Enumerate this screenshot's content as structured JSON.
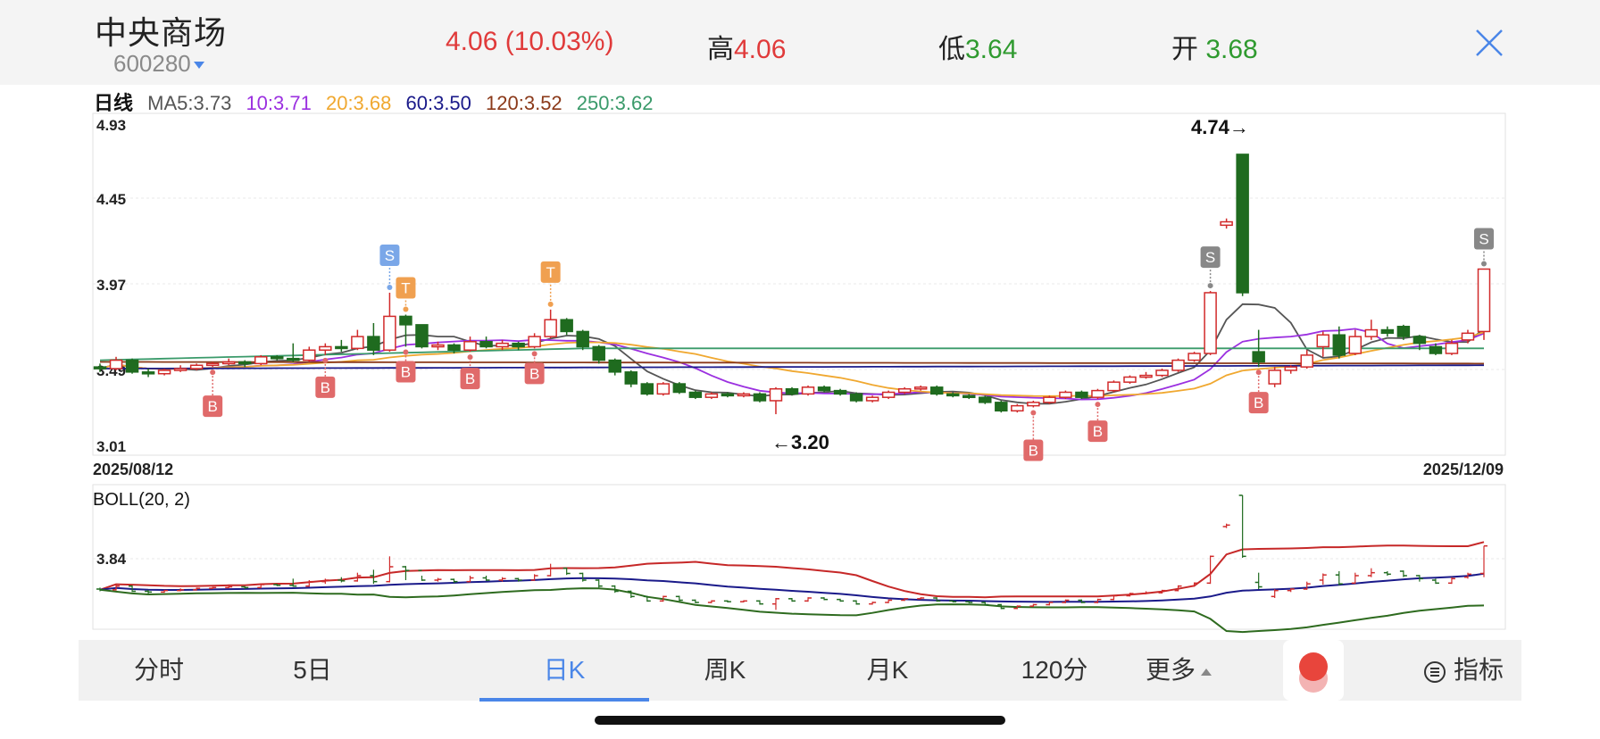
{
  "stock": {
    "name": "中央商场",
    "code": "600280",
    "price": "4.06",
    "change_pct": "(10.03%)",
    "high_label": "高",
    "high_value": "4.06",
    "low_label": "低",
    "low_value": "3.64",
    "open_label": "开",
    "open_value": "3.68"
  },
  "ma_legend": {
    "period": "日线",
    "ma5": "MA5:3.73",
    "ma10": "10:3.71",
    "ma20": "20:3.68",
    "ma60": "60:3.50",
    "ma120": "120:3.52",
    "ma250": "250:3.62"
  },
  "colors": {
    "up": "#d12a2a",
    "down": "#1f6b1f",
    "ma5": "#555555",
    "ma10": "#9b30e0",
    "ma20": "#f0a830",
    "ma60": "#1a1a8a",
    "ma120": "#8b3a1a",
    "ma250": "#3a9a6a",
    "accent": "#4a86e8"
  },
  "chart_data": [
    {
      "type": "candlestick",
      "title": "",
      "y_ticks": [
        "4.93",
        "4.45",
        "3.97",
        "3.49",
        "3.01"
      ],
      "ylim": [
        3.01,
        4.93
      ],
      "x_start_label": "2025/08/12",
      "x_end_label": "2025/12/09",
      "annotations": {
        "max_label": "4.74→",
        "min_label": "←3.20"
      },
      "signals": {
        "buy": "B",
        "sell": "S",
        "t": "T"
      },
      "candles": [
        [
          3.48,
          3.47,
          3.5,
          3.45
        ],
        [
          3.47,
          3.52,
          3.54,
          3.46
        ],
        [
          3.52,
          3.45,
          3.53,
          3.44
        ],
        [
          3.45,
          3.44,
          3.47,
          3.42
        ],
        [
          3.44,
          3.46,
          3.47,
          3.43
        ],
        [
          3.46,
          3.47,
          3.49,
          3.45
        ],
        [
          3.47,
          3.49,
          3.5,
          3.46
        ],
        [
          3.49,
          3.5,
          3.51,
          3.48
        ],
        [
          3.5,
          3.51,
          3.53,
          3.49
        ],
        [
          3.51,
          3.5,
          3.52,
          3.48
        ],
        [
          3.5,
          3.54,
          3.55,
          3.49
        ],
        [
          3.54,
          3.53,
          3.55,
          3.52
        ],
        [
          3.53,
          3.52,
          3.62,
          3.51
        ],
        [
          3.52,
          3.58,
          3.6,
          3.51
        ],
        [
          3.58,
          3.6,
          3.62,
          3.55
        ],
        [
          3.6,
          3.59,
          3.64,
          3.57
        ],
        [
          3.59,
          3.66,
          3.7,
          3.58
        ],
        [
          3.66,
          3.58,
          3.74,
          3.55
        ],
        [
          3.58,
          3.78,
          3.92,
          3.57
        ],
        [
          3.78,
          3.73,
          3.79,
          3.6
        ],
        [
          3.73,
          3.6,
          3.66,
          3.59
        ],
        [
          3.6,
          3.61,
          3.63,
          3.58
        ],
        [
          3.61,
          3.58,
          3.62,
          3.56
        ],
        [
          3.58,
          3.63,
          3.66,
          3.57
        ],
        [
          3.63,
          3.6,
          3.66,
          3.59
        ],
        [
          3.6,
          3.62,
          3.64,
          3.58
        ],
        [
          3.62,
          3.6,
          3.63,
          3.58
        ],
        [
          3.6,
          3.66,
          3.68,
          3.59
        ],
        [
          3.66,
          3.76,
          3.82,
          3.65
        ],
        [
          3.76,
          3.69,
          3.77,
          3.67
        ],
        [
          3.69,
          3.6,
          3.7,
          3.58
        ],
        [
          3.6,
          3.52,
          3.61,
          3.5
        ],
        [
          3.52,
          3.45,
          3.53,
          3.43
        ],
        [
          3.45,
          3.38,
          3.46,
          3.36
        ],
        [
          3.38,
          3.32,
          3.39,
          3.31
        ],
        [
          3.32,
          3.38,
          3.39,
          3.31
        ],
        [
          3.38,
          3.33,
          3.39,
          3.32
        ],
        [
          3.33,
          3.3,
          3.34,
          3.29
        ],
        [
          3.3,
          3.32,
          3.33,
          3.29
        ],
        [
          3.32,
          3.31,
          3.33,
          3.3
        ],
        [
          3.31,
          3.32,
          3.33,
          3.3
        ],
        [
          3.32,
          3.28,
          3.33,
          3.27
        ],
        [
          3.28,
          3.35,
          3.36,
          3.2
        ],
        [
          3.35,
          3.32,
          3.36,
          3.31
        ],
        [
          3.32,
          3.36,
          3.37,
          3.31
        ],
        [
          3.36,
          3.34,
          3.37,
          3.33
        ],
        [
          3.34,
          3.32,
          3.35,
          3.31
        ],
        [
          3.32,
          3.28,
          3.33,
          3.27
        ],
        [
          3.28,
          3.3,
          3.31,
          3.27
        ],
        [
          3.3,
          3.33,
          3.34,
          3.29
        ],
        [
          3.33,
          3.35,
          3.36,
          3.32
        ],
        [
          3.35,
          3.36,
          3.37,
          3.34
        ],
        [
          3.36,
          3.32,
          3.37,
          3.31
        ],
        [
          3.32,
          3.31,
          3.33,
          3.3
        ],
        [
          3.31,
          3.3,
          3.32,
          3.29
        ],
        [
          3.3,
          3.27,
          3.31,
          3.26
        ],
        [
          3.27,
          3.22,
          3.28,
          3.21
        ],
        [
          3.22,
          3.25,
          3.26,
          3.21
        ],
        [
          3.25,
          3.27,
          3.28,
          3.24
        ],
        [
          3.27,
          3.3,
          3.31,
          3.26
        ],
        [
          3.3,
          3.33,
          3.34,
          3.29
        ],
        [
          3.33,
          3.3,
          3.34,
          3.29
        ],
        [
          3.3,
          3.34,
          3.35,
          3.29
        ],
        [
          3.34,
          3.39,
          3.4,
          3.33
        ],
        [
          3.39,
          3.42,
          3.43,
          3.38
        ],
        [
          3.42,
          3.43,
          3.45,
          3.41
        ],
        [
          3.43,
          3.46,
          3.47,
          3.42
        ],
        [
          3.46,
          3.52,
          3.53,
          3.45
        ],
        [
          3.52,
          3.56,
          3.57,
          3.51
        ],
        [
          3.56,
          3.92,
          3.93,
          3.55
        ],
        [
          4.32,
          4.34,
          4.36,
          4.3
        ],
        [
          4.74,
          3.92,
          4.74,
          3.9
        ],
        [
          3.57,
          3.51,
          3.7,
          3.48
        ],
        [
          3.38,
          3.46,
          3.48,
          3.36
        ],
        [
          3.46,
          3.48,
          3.49,
          3.44
        ],
        [
          3.48,
          3.55,
          3.58,
          3.47
        ],
        [
          3.6,
          3.67,
          3.69,
          3.54
        ],
        [
          3.67,
          3.55,
          3.72,
          3.53
        ],
        [
          3.56,
          3.66,
          3.7,
          3.55
        ],
        [
          3.66,
          3.7,
          3.76,
          3.64
        ],
        [
          3.7,
          3.68,
          3.72,
          3.66
        ],
        [
          3.72,
          3.66,
          3.73,
          3.64
        ],
        [
          3.66,
          3.62,
          3.67,
          3.58
        ],
        [
          3.6,
          3.56,
          3.62,
          3.55
        ],
        [
          3.56,
          3.62,
          3.64,
          3.55
        ],
        [
          3.64,
          3.68,
          3.7,
          3.62
        ],
        [
          3.69,
          4.06,
          4.06,
          3.64
        ]
      ]
    },
    {
      "type": "candlestick",
      "title": "BOLL(20, 2)",
      "y_tick": "3.84"
    }
  ],
  "tabs": [
    "分时",
    "5日",
    "日K",
    "周K",
    "月K",
    "120分",
    "更多"
  ],
  "active_tab": "日K",
  "indicator_button": "指标"
}
